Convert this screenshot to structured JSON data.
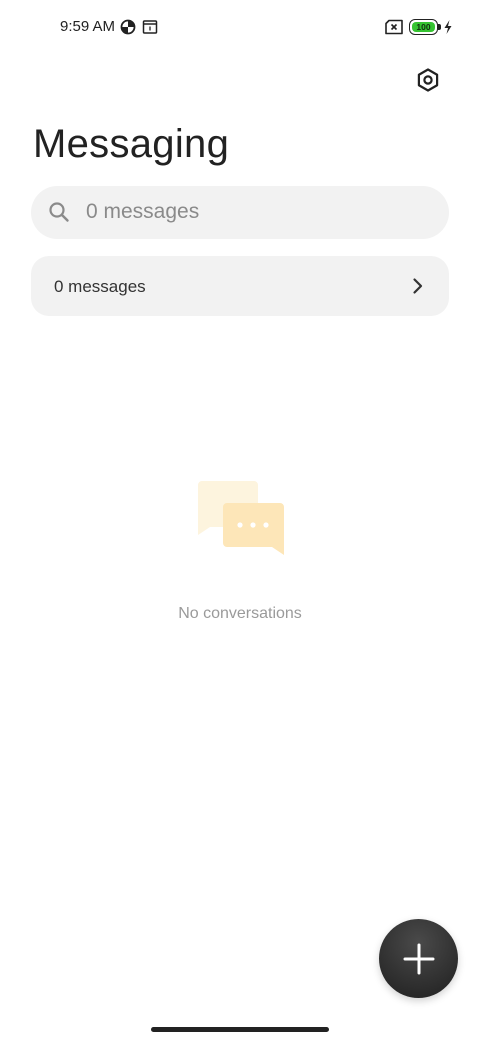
{
  "status_bar": {
    "time": "9:59 AM",
    "battery_level": "100",
    "battery_color": "#35c331",
    "icons": [
      "data-saver-icon",
      "calendar-icon",
      "sim-missing-icon",
      "battery-icon",
      "charging-bolt-icon"
    ]
  },
  "header": {
    "title": "Messaging",
    "settings_icon": "settings-hex-icon"
  },
  "search": {
    "placeholder": "0 messages",
    "icon": "search-icon"
  },
  "messages_row": {
    "label": "0 messages",
    "icon": "chevron-right-icon"
  },
  "empty_state": {
    "illustration": "chat-bubbles-icon",
    "text": "No conversations"
  },
  "fab": {
    "icon": "plus-icon"
  },
  "colors": {
    "accent_bubble_back": "#fdf4de",
    "accent_bubble_front": "#fde6b8",
    "fab": "#2a2a2a"
  }
}
